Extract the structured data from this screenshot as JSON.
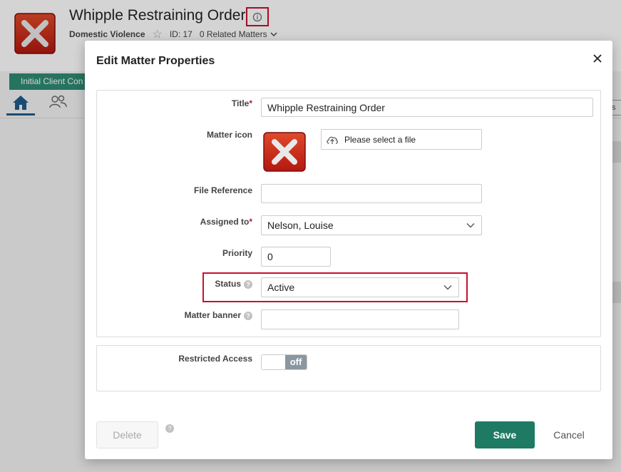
{
  "matter": {
    "title": "Whipple Restraining Order",
    "type": "Domestic Violence",
    "id_label": "ID: 17",
    "related_matters": "0 Related Matters",
    "tab_label": "Initial Client Con",
    "right_button_text": "s"
  },
  "modal": {
    "title": "Edit Matter Properties",
    "fields": {
      "title_label": "Title",
      "title_value": "Whipple Restraining Order",
      "matter_icon_label": "Matter icon",
      "file_select_label": "Please select a file",
      "file_reference_label": "File Reference",
      "file_reference_value": "",
      "assigned_to_label": "Assigned to",
      "assigned_to_value": "Nelson, Louise",
      "priority_label": "Priority",
      "priority_value": "0",
      "status_label": "Status",
      "status_value": "Active",
      "matter_banner_label": "Matter banner",
      "matter_banner_value": "",
      "restricted_access_label": "Restricted Access",
      "restricted_access_state": "off"
    },
    "required_marker": "*",
    "help_glyph": "?",
    "buttons": {
      "delete": "Delete",
      "save": "Save",
      "cancel": "Cancel"
    }
  },
  "icons": {
    "matter_icon": "red-x-icon",
    "info": "info-circle-icon",
    "close": "close-icon",
    "upload": "cloud-upload-icon",
    "dropdown": "chevron-down-icon"
  },
  "colors": {
    "save": "#1e7a63",
    "highlight": "#c8102e",
    "tab": "#2e8b74",
    "toggle_off": "#8a97a1"
  }
}
